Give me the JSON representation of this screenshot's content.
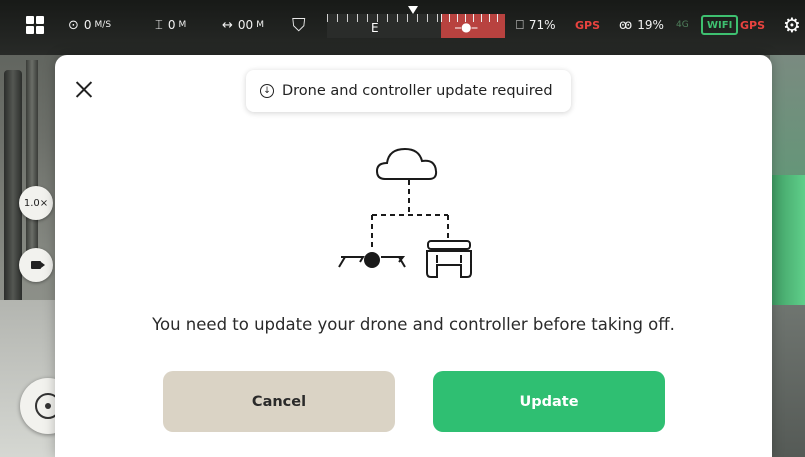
{
  "status_bar": {
    "speed": "0",
    "speed_unit": "M/S",
    "altitude": "0",
    "altitude_unit": "M",
    "distance": "00",
    "distance_unit": "M",
    "compass_heading": "E",
    "controller_battery": "71%",
    "gps_controller": "GPS",
    "drone_battery": "19%",
    "signal_badge": "4G",
    "wifi_badge": "WIFI",
    "gps_drone": "GPS",
    "colors": {
      "warning": "#e8433f",
      "ok": "#3ec070"
    }
  },
  "side_controls": {
    "zoom_label": "1.0×"
  },
  "modal": {
    "badge_text": "Drone and controller update required",
    "message": "You need to update your drone and controller before taking off.",
    "cancel_label": "Cancel",
    "update_label": "Update",
    "colors": {
      "cancel_bg": "#dad3c5",
      "update_bg": "#2fbf72"
    },
    "illustration_icons": [
      "cloud-icon",
      "drone-icon",
      "controller-icon"
    ]
  }
}
